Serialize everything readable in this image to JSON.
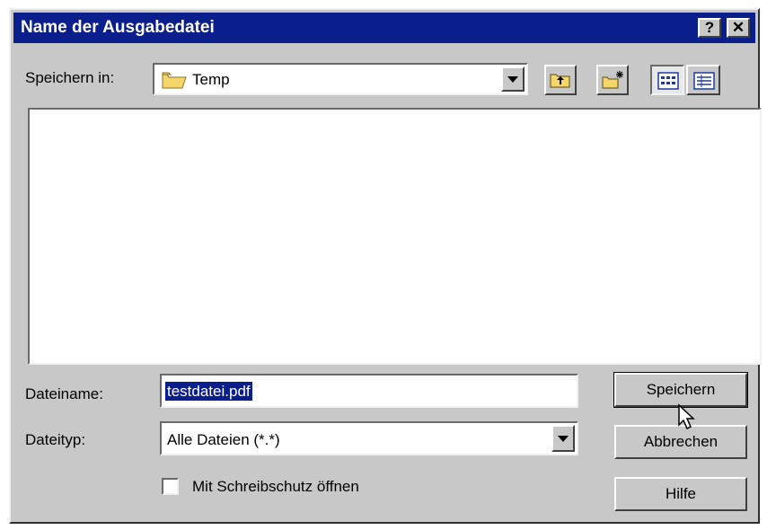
{
  "window": {
    "title": "Name der Ausgabedatei",
    "help_button": "?",
    "close_button": "✕"
  },
  "toolbar": {
    "save_in_label": "Speichern in:",
    "save_in_value": "Temp"
  },
  "form": {
    "filename_label": "Dateiname:",
    "filename_value": "testdatei.pdf",
    "filetype_label": "Dateityp:",
    "filetype_value": "Alle Dateien (*.*)",
    "readonly_label": "Mit Schreibschutz öffnen",
    "readonly_checked": false
  },
  "buttons": {
    "save": "Speichern",
    "cancel": "Abbrechen",
    "help": "Hilfe"
  },
  "colors": {
    "titlebar": "#0a1e8c",
    "dialog_bg": "#c8c8c8",
    "selection": "#0a1e8c"
  }
}
